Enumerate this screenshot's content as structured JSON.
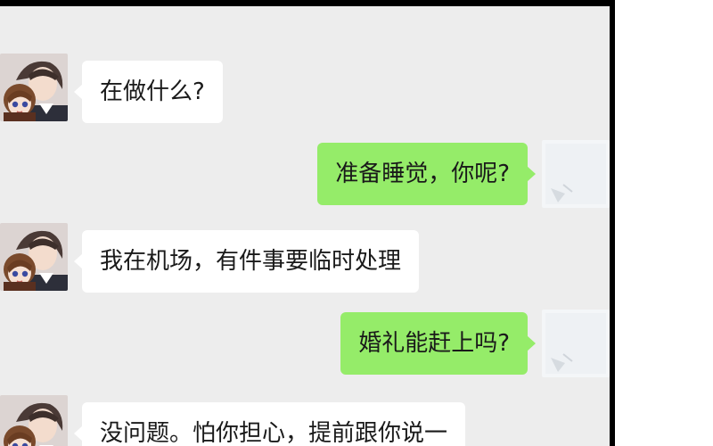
{
  "chat": {
    "messages": [
      {
        "sender": "contact",
        "avatar": "contact-avatar",
        "text": "在做什么?"
      },
      {
        "sender": "self",
        "avatar": "self-avatar",
        "text": "准备睡觉，你呢?"
      },
      {
        "sender": "contact",
        "avatar": "contact-avatar",
        "text": "我在机场，有件事要临时处理"
      },
      {
        "sender": "self",
        "avatar": "self-avatar",
        "text": "婚礼能赶上吗?"
      },
      {
        "sender": "contact",
        "avatar": "contact-avatar",
        "text": "没问题。怕你担心，提前跟你说一"
      }
    ]
  },
  "colors": {
    "background": "#ededed",
    "incoming_bubble": "#ffffff",
    "outgoing_bubble": "#95ec69",
    "frame": "#000000"
  }
}
